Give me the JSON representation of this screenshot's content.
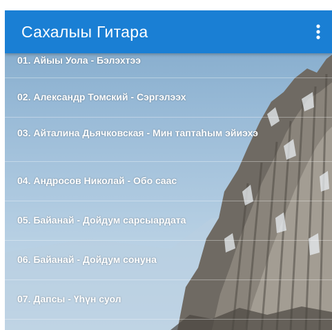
{
  "app_bar": {
    "title": "Сахалыы Гитара",
    "menu_icon": "more-vert-icon",
    "color": "#1a7fd4"
  },
  "tracks": [
    {
      "label": "01. Айыы Уола - Бэлэхтээ"
    },
    {
      "label": "02. Александр Томский - Сэргэлээх"
    },
    {
      "label": "03. Айталина Дьячковская - Мин таптаһым эйиэхэ"
    },
    {
      "label": "04. Андросов Николай - Oбo caac"
    },
    {
      "label": "05. Байанай - Дойдум сарсыардата"
    },
    {
      "label": "06. Байанай - Дойдум сонуна"
    },
    {
      "label": "07. Дапсы - Үһүн суол"
    }
  ]
}
